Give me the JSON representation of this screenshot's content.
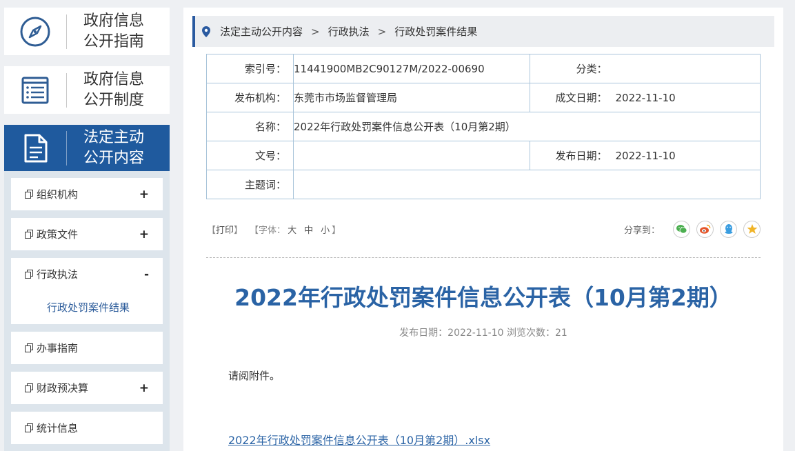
{
  "sidebar": {
    "big_buttons": [
      {
        "label_line1": "政府信息",
        "label_line2": "公开指南",
        "icon": "compass-icon"
      },
      {
        "label_line1": "政府信息",
        "label_line2": "公开制度",
        "icon": "list-document-icon"
      },
      {
        "label_line1": "法定主动",
        "label_line2": "公开内容",
        "icon": "document-icon"
      }
    ],
    "menu": [
      {
        "label": "组织机构",
        "toggle": "+"
      },
      {
        "label": "政策文件",
        "toggle": "+"
      },
      {
        "label": "行政执法",
        "toggle": "-",
        "sub": "行政处罚案件结果"
      },
      {
        "label": "办事指南",
        "toggle": ""
      },
      {
        "label": "财政预决算",
        "toggle": "+"
      },
      {
        "label": "统计信息",
        "toggle": ""
      }
    ]
  },
  "breadcrumb": [
    "法定主动公开内容",
    "行政执法",
    "行政处罚案件结果"
  ],
  "meta": {
    "index_label": "索引号：",
    "index_value": "11441900MB2C90127M/2022-00690",
    "category_label": "分类：",
    "category_value": "",
    "org_label": "发布机构：",
    "org_value": "东莞市市场监督管理局",
    "created_label": "成文日期：",
    "created_value": "2022-11-10",
    "name_label": "名称：",
    "name_value": "2022年行政处罚案件信息公开表（10月第2期）",
    "docno_label": "文号：",
    "docno_value": "",
    "pub_label": "发布日期：",
    "pub_value": "2022-11-10",
    "subject_label": "主题词：",
    "subject_value": ""
  },
  "tools": {
    "print_open": "【",
    "print": "打印",
    "print_close": "】",
    "font_open": "【字体：",
    "font_large": "大",
    "font_medium": "中",
    "font_small": "小",
    "font_close": "】",
    "share_label": "分享到：",
    "share_icons": [
      "wechat-icon",
      "weibo-icon",
      "qq-icon",
      "qzone-icon"
    ]
  },
  "article": {
    "title": "2022年行政处罚案件信息公开表（10月第2期）",
    "pubinfo": "发布日期：2022-11-10  浏览次数：21",
    "body": "请阅附件。",
    "attachment": "2022年行政处罚案件信息公开表（10月第2期）.xlsx"
  },
  "colors": {
    "accent": "#1f5a9e",
    "title": "#2a63a5",
    "wechat": "#4caf50",
    "weibo": "#e5562b",
    "qq": "#3a9de0",
    "qzone": "#f0b428"
  }
}
